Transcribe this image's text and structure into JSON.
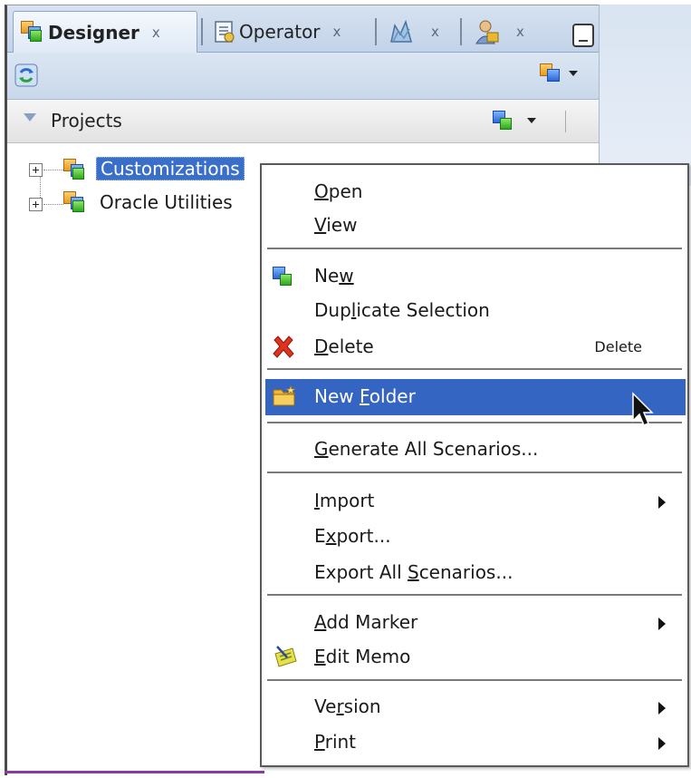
{
  "tabs": [
    {
      "label": "Designer",
      "close": "x",
      "icon": "designer-icon",
      "active": true
    },
    {
      "label": "Operator",
      "close": "x",
      "icon": "operator-icon",
      "active": false
    },
    {
      "label": "",
      "close": "x",
      "icon": "topology-icon",
      "active": false
    },
    {
      "label": "",
      "close": "x",
      "icon": "security-icon",
      "active": false
    }
  ],
  "accordion": {
    "title": "Projects"
  },
  "tree": [
    {
      "label": "Customizations",
      "selected": true
    },
    {
      "label": "Oracle Utilities",
      "selected": false
    }
  ],
  "menu": {
    "open": {
      "pre": "",
      "key": "O",
      "post": "pen"
    },
    "view": {
      "pre": "",
      "key": "V",
      "post": "iew"
    },
    "new": {
      "pre": "Ne",
      "key": "w",
      "post": ""
    },
    "duplicate": {
      "pre": "Dup",
      "key": "l",
      "post": "icate Selection"
    },
    "delete": {
      "pre": "",
      "key": "D",
      "post": "elete",
      "shortcut": "Delete"
    },
    "new_folder": {
      "pre": "New ",
      "key": "F",
      "post": "older"
    },
    "generate": {
      "pre": "",
      "key": "G",
      "post": "enerate All Scenarios..."
    },
    "import": {
      "pre": "",
      "key": "I",
      "post": "mport"
    },
    "export": {
      "pre": "E",
      "key": "x",
      "post": "port..."
    },
    "export_all": {
      "pre": "Export All ",
      "key": "S",
      "post": "cenarios..."
    },
    "add_marker": {
      "pre": "",
      "key": "A",
      "post": "dd Marker"
    },
    "edit_memo": {
      "pre": "",
      "key": "E",
      "post": "dit Memo"
    },
    "version": {
      "pre": "Ve",
      "key": "r",
      "post": "sion"
    },
    "print": {
      "pre": "",
      "key": "P",
      "post": "rint"
    }
  },
  "colors": {
    "selection": "#3565c2",
    "tab_bar": "#c3d3e8"
  }
}
